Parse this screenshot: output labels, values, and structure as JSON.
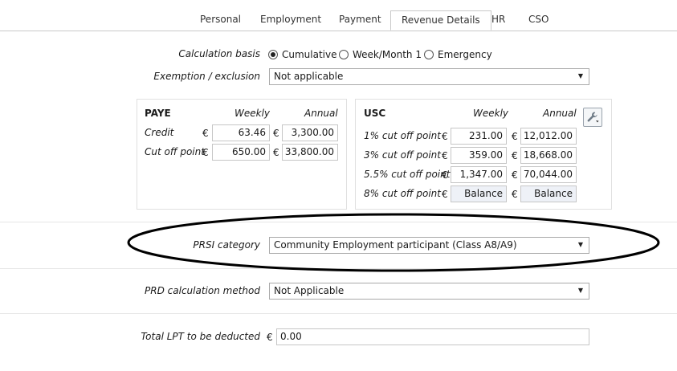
{
  "tabs": [
    "Personal",
    "Employment",
    "Payment",
    "Revenue Details",
    "HR",
    "CSO"
  ],
  "calc_basis": {
    "label": "Calculation basis",
    "options": [
      "Cumulative",
      "Week/Month 1",
      "Emergency"
    ],
    "selected": "Cumulative"
  },
  "exemption": {
    "label": "Exemption / exclusion",
    "value": "Not applicable"
  },
  "paye": {
    "title": "PAYE",
    "weekly_header": "Weekly",
    "annual_header": "Annual",
    "currency": "€",
    "rows": [
      {
        "label": "Credit",
        "weekly": "63.46",
        "annual": "3,300.00"
      },
      {
        "label": "Cut off point",
        "weekly": "650.00",
        "annual": "33,800.00"
      }
    ]
  },
  "usc": {
    "title": "USC",
    "weekly_header": "Weekly",
    "annual_header": "Annual",
    "currency": "€",
    "rows": [
      {
        "label": "1% cut off point",
        "weekly": "231.00",
        "annual": "12,012.00"
      },
      {
        "label": "3% cut off point",
        "weekly": "359.00",
        "annual": "18,668.00"
      },
      {
        "label": "5.5% cut off point",
        "weekly": "1,347.00",
        "annual": "70,044.00"
      },
      {
        "label": "8% cut off point",
        "weekly": "Balance",
        "annual": "Balance"
      }
    ]
  },
  "prsi": {
    "label": "PRSI category",
    "value": "Community Employment participant (Class A8/A9)"
  },
  "prd": {
    "label": "PRD calculation method",
    "value": "Not Applicable"
  },
  "lpt": {
    "label": "Total LPT to be deducted",
    "currency": "€",
    "value": "0.00"
  },
  "icons": {
    "dropdown": "dropdown-arrow-icon",
    "settings": "wrench-icon"
  }
}
